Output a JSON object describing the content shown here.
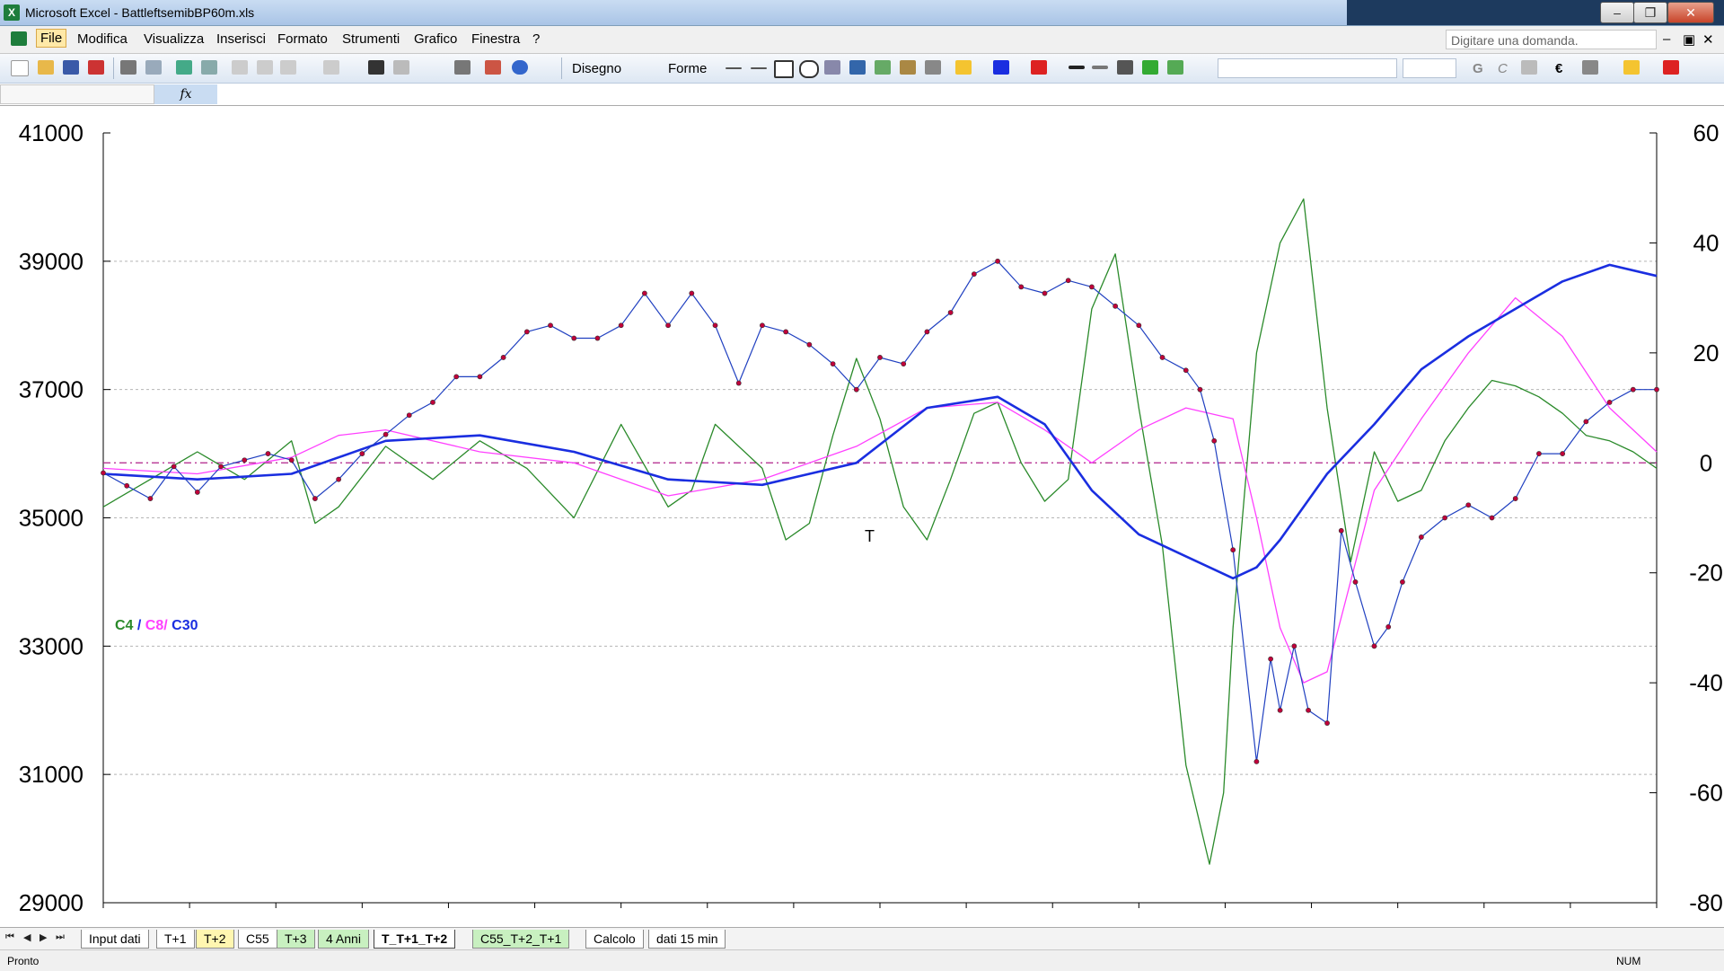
{
  "window": {
    "app_icon": "X",
    "title": "Microsoft Excel - BattleftsemibBP60m.xls",
    "minimize": "‒",
    "restore": "❐",
    "close": "✕"
  },
  "menu": {
    "items": [
      "File",
      "Modifica",
      "Visualizza",
      "Inserisci",
      "Formato",
      "Strumenti",
      "Grafico",
      "Finestra",
      "?"
    ],
    "help_placeholder": "Digitare una domanda.",
    "window_controls": [
      "–",
      "▣",
      "✕"
    ]
  },
  "toolbar": {
    "disegno": "Disegno",
    "forme": "Forme"
  },
  "formula_bar": {
    "fx": "fx"
  },
  "chart_data": {
    "type": "line",
    "y_left": {
      "min": 29000,
      "max": 41000,
      "ticks": [
        "41000",
        "39000",
        "37000",
        "35000",
        "33000",
        "31000",
        "29000"
      ]
    },
    "y_right": {
      "min": -80,
      "max": 60,
      "ticks": [
        "60",
        "40",
        "20",
        "0",
        "-20",
        "-40",
        "-60",
        "-80"
      ]
    },
    "legend": {
      "c4": "C4",
      "sep1": " / ",
      "c8": "C8/",
      "c30": " C30"
    },
    "annotation": "T",
    "colors": {
      "price": "#2040c0",
      "markers": "#c0003a",
      "c4": "#2a8a2a",
      "c8": "#ff40ff",
      "c30": "#1a2ee0",
      "zero": "#b0208a"
    },
    "series": [
      {
        "name": "price",
        "axis": "left",
        "x": [
          0,
          5,
          10,
          15,
          20,
          25,
          30,
          35,
          40,
          45,
          50,
          55,
          60,
          65,
          70,
          75,
          80,
          85,
          90,
          95,
          100,
          105,
          110,
          115,
          120,
          125,
          130,
          135,
          140,
          145,
          150,
          155,
          160,
          165,
          170,
          175,
          180,
          185,
          190,
          195,
          200,
          205,
          210,
          215,
          220,
          225,
          230,
          233,
          236,
          240,
          245,
          248,
          250,
          253,
          256,
          260,
          263,
          266,
          270,
          273,
          276,
          280,
          285,
          290,
          295,
          300,
          305,
          310,
          315,
          320,
          325,
          330
        ],
        "y": [
          35700,
          35500,
          35300,
          35800,
          35400,
          35800,
          35900,
          36000,
          35900,
          35300,
          35600,
          36000,
          36300,
          36600,
          36800,
          37200,
          37200,
          37500,
          37900,
          38000,
          37800,
          37800,
          38000,
          38500,
          38000,
          38500,
          38000,
          37100,
          38000,
          37900,
          37700,
          37400,
          37000,
          37500,
          37400,
          37900,
          38200,
          38800,
          39000,
          38600,
          38500,
          38700,
          38600,
          38300,
          38000,
          37500,
          37300,
          37000,
          36200,
          34500,
          31200,
          32800,
          32000,
          33000,
          32000,
          31800,
          34800,
          34000,
          33000,
          33300,
          34000,
          34700,
          35000,
          35200,
          35000,
          35300,
          36000,
          36000,
          36500,
          36800,
          37000,
          37000
        ]
      },
      {
        "name": "",
        "axis": "right",
        "x": [
          0,
          10,
          20,
          30,
          40,
          45,
          50,
          60,
          70,
          80,
          90,
          100,
          110,
          120,
          125,
          130,
          140,
          145,
          150,
          155,
          160,
          165,
          170,
          175,
          180,
          185,
          190,
          195,
          200,
          205,
          210,
          215,
          220,
          225,
          230,
          235,
          238,
          240,
          245,
          250,
          255,
          260,
          265,
          270,
          275,
          280,
          285,
          290,
          295,
          300,
          305,
          310,
          315,
          320,
          325,
          330
        ],
        "y": [
          -8,
          -3,
          2,
          -3,
          4,
          -11,
          -8,
          3,
          -3,
          4,
          -1,
          -10,
          7,
          -8,
          -5,
          7,
          -1,
          -14,
          -11,
          5,
          19,
          8,
          -8,
          -14,
          -3,
          9,
          11,
          0,
          -7,
          -3,
          28,
          38,
          10,
          -15,
          -55,
          -73,
          -60,
          -30,
          20,
          40,
          48,
          10,
          -18,
          2,
          -7,
          -5,
          4,
          10,
          15,
          14,
          12,
          9,
          5,
          4,
          2,
          -1
        ]
      },
      {
        "name": "",
        "axis": "right",
        "x": [
          0,
          20,
          40,
          50,
          60,
          80,
          100,
          120,
          140,
          160,
          175,
          190,
          200,
          210,
          220,
          230,
          240,
          245,
          250,
          255,
          260,
          270,
          280,
          290,
          300,
          310,
          320,
          330
        ],
        "y": [
          -1,
          -2,
          1,
          5,
          6,
          2,
          0,
          -6,
          -3,
          3,
          10,
          11,
          6,
          0,
          6,
          10,
          8,
          -10,
          -30,
          -40,
          -38,
          -5,
          8,
          20,
          30,
          23,
          10,
          2
        ]
      },
      {
        "name": "",
        "axis": "right",
        "x": [
          0,
          20,
          40,
          50,
          60,
          80,
          100,
          120,
          140,
          160,
          175,
          190,
          200,
          210,
          220,
          230,
          240,
          245,
          250,
          255,
          260,
          270,
          280,
          290,
          300,
          310,
          320,
          330
        ],
        "y": [
          -2,
          -3,
          -2,
          1,
          4,
          5,
          2,
          -3,
          -4,
          0,
          10,
          12,
          7,
          -5,
          -13,
          -17,
          -21,
          -19,
          -14,
          -8,
          -2,
          7,
          17,
          23,
          28,
          33,
          36,
          34
        ]
      }
    ]
  },
  "sheet_tabs": {
    "nav": [
      "⏮",
      "◀",
      "▶",
      "⏭"
    ],
    "items": [
      "Input dati",
      "T+1",
      "T+2",
      "C55",
      "T+3",
      "4 Anni",
      "T_T+1_T+2",
      "C55_T+2_T+1",
      "Calcolo",
      "dati 15 min"
    ]
  },
  "status": {
    "left": "Pronto",
    "num": "NUM"
  }
}
